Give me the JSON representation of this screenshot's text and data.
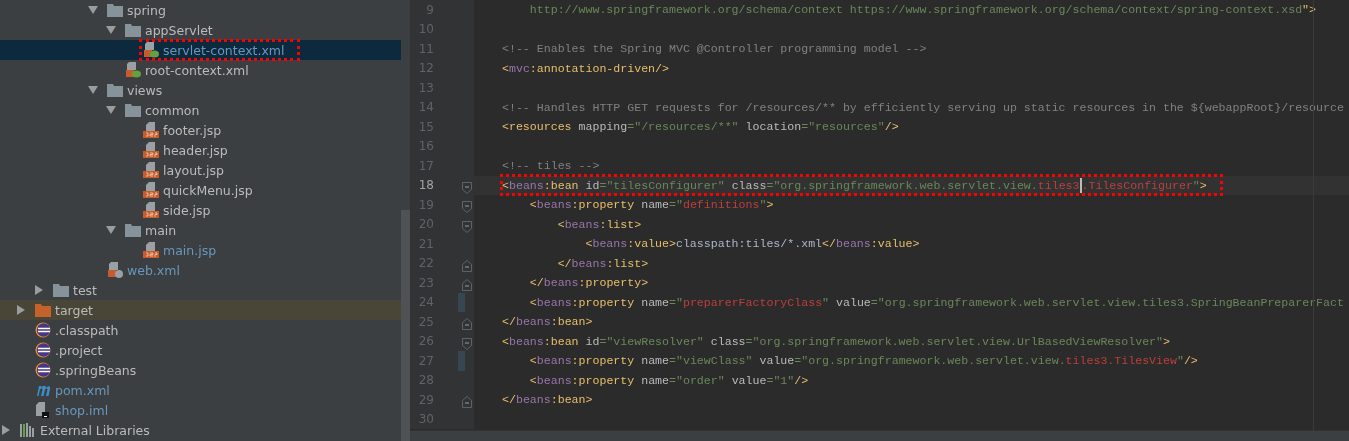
{
  "project_tree": {
    "items": [
      {
        "children": [
          {
            "children": [
              {
                "children": [
                  {
                    "children": [
                      {
                        "children": [
                          {
                            "label": "spring",
                            "kind": "folder",
                            "expanded": true,
                            "children": [
                              {
                                "label": "appServlet",
                                "kind": "folder",
                                "expanded": true,
                                "children": [
                                  {
                                    "label": "servlet-context.xml",
                                    "kind": "spring-xml",
                                    "modified": true,
                                    "selected": true,
                                    "marked": true
                                  }
                                ]
                              },
                              {
                                "label": "root-context.xml",
                                "kind": "spring-xml",
                                "modified": false,
                                "selected": false,
                                "marked": false
                              }
                            ]
                          },
                          {
                            "label": "views",
                            "kind": "folder",
                            "expanded": true,
                            "children": [
                              {
                                "label": "common",
                                "kind": "folder",
                                "expanded": true,
                                "children": [
                                  {
                                    "label": "footer.jsp",
                                    "kind": "jsp",
                                    "modified": false,
                                    "selected": false,
                                    "marked": false
                                  },
                                  {
                                    "label": "header.jsp",
                                    "kind": "jsp",
                                    "modified": false,
                                    "selected": false,
                                    "marked": false
                                  },
                                  {
                                    "label": "layout.jsp",
                                    "kind": "jsp",
                                    "modified": false,
                                    "selected": false,
                                    "marked": false
                                  },
                                  {
                                    "label": "quickMenu.jsp",
                                    "kind": "jsp",
                                    "modified": false,
                                    "selected": false,
                                    "marked": false
                                  },
                                  {
                                    "label": "side.jsp",
                                    "kind": "jsp",
                                    "modified": false,
                                    "selected": false,
                                    "marked": false
                                  }
                                ]
                              },
                              {
                                "label": "main",
                                "kind": "folder",
                                "expanded": true,
                                "children": [
                                  {
                                    "label": "main.jsp",
                                    "kind": "jsp",
                                    "modified": true,
                                    "selected": false,
                                    "marked": false
                                  }
                                ]
                              }
                            ]
                          },
                          {
                            "label": "web.xml",
                            "kind": "web-xml",
                            "modified": true,
                            "selected": false,
                            "marked": false
                          }
                        ]
                      }
                    ]
                  }
                ]
              },
              {
                "label": "test",
                "kind": "folder",
                "expanded": false
              }
            ]
          },
          {
            "label": "target",
            "kind": "excluded-folder",
            "expanded": false,
            "highlighted": true
          },
          {
            "label": ".classpath",
            "kind": "eclipse",
            "modified": false,
            "selected": false,
            "marked": false
          },
          {
            "label": ".project",
            "kind": "eclipse",
            "modified": false,
            "selected": false,
            "marked": false
          },
          {
            "label": ".springBeans",
            "kind": "eclipse",
            "modified": false,
            "selected": false,
            "marked": false
          },
          {
            "label": "pom.xml",
            "kind": "maven",
            "modified": true,
            "selected": false,
            "marked": false
          },
          {
            "label": "shop.iml",
            "kind": "module",
            "modified": true,
            "selected": false,
            "marked": false
          }
        ]
      },
      {
        "label": "External Libraries",
        "kind": "libraries",
        "expanded": false
      }
    ]
  },
  "editor": {
    "lines": [
      {
        "number": "9",
        "tokens": [
          {
            "kind": "value",
            "text": "    http://www.springframework.org/schema/context https://www.springframework.org/schema/context/spring-context.xsd"
          },
          {
            "kind": "tag",
            "text": "\">"
          }
        ]
      },
      {
        "number": "10"
      },
      {
        "number": "11",
        "tokens": [
          {
            "kind": "comment",
            "text": "<!-- Enables the Spring MVC @Controller programming model -->"
          }
        ]
      },
      {
        "number": "12",
        "tokens": [
          {
            "kind": "tag",
            "text": "<"
          },
          {
            "kind": "ns",
            "text": "mvc"
          },
          {
            "kind": "tag",
            "text": ":annotation-driven/>"
          }
        ]
      },
      {
        "number": "13"
      },
      {
        "number": "14",
        "tokens": [
          {
            "kind": "comment",
            "text": "<!-- Handles HTTP GET requests for /resources/** by efficiently serving up static resources in the ${webappRoot}/resource"
          }
        ]
      },
      {
        "number": "15",
        "tokens": [
          {
            "kind": "tag",
            "text": "<resources"
          },
          {
            "kind": "attr",
            "text": " mapping"
          },
          {
            "kind": "value",
            "text": "=\"/resources/**\""
          },
          {
            "kind": "attr",
            "text": " location"
          },
          {
            "kind": "value",
            "text": "=\"resources\""
          },
          {
            "kind": "tag",
            "text": "/>"
          }
        ]
      },
      {
        "number": "16"
      },
      {
        "number": "17",
        "tokens": [
          {
            "kind": "comment",
            "text": "<!-- tiles -->"
          }
        ]
      },
      {
        "number": "18",
        "current": true,
        "marked": true,
        "fold_start": true,
        "tokens": [
          {
            "kind": "tag",
            "text": "<"
          },
          {
            "kind": "ns",
            "text": "beans"
          },
          {
            "kind": "tag",
            "text": ":bean"
          },
          {
            "kind": "attr",
            "text": " id"
          },
          {
            "kind": "value",
            "text": "=\"tilesConfigurer\""
          },
          {
            "kind": "attr",
            "text": " class"
          },
          {
            "kind": "value",
            "text": "=\"org.springframework.web.servlet.view."
          },
          {
            "kind": "error",
            "text": "tiles3",
            "caret_after": true
          },
          {
            "kind": "error",
            "text": ".TilesConfigurer"
          },
          {
            "kind": "value",
            "text": "\""
          },
          {
            "kind": "tag",
            "text": ">"
          }
        ]
      },
      {
        "number": "19",
        "fold_start": true,
        "tokens": [
          {
            "kind": "tag",
            "text": "    <"
          },
          {
            "kind": "ns",
            "text": "beans"
          },
          {
            "kind": "tag",
            "text": ":property"
          },
          {
            "kind": "attr",
            "text": " name"
          },
          {
            "kind": "value",
            "text": "=\""
          },
          {
            "kind": "error",
            "text": "definitions"
          },
          {
            "kind": "value",
            "text": "\""
          },
          {
            "kind": "tag",
            "text": ">"
          }
        ]
      },
      {
        "number": "20",
        "fold_start": true,
        "tokens": [
          {
            "kind": "tag",
            "text": "        <"
          },
          {
            "kind": "ns",
            "text": "beans"
          },
          {
            "kind": "tag",
            "text": ":list>"
          }
        ]
      },
      {
        "number": "21",
        "tokens": [
          {
            "kind": "tag",
            "text": "            <"
          },
          {
            "kind": "ns",
            "text": "beans"
          },
          {
            "kind": "tag",
            "text": ":value>"
          },
          {
            "kind": "text",
            "text": "classpath:tiles/*.xml"
          },
          {
            "kind": "tag",
            "text": "</"
          },
          {
            "kind": "ns",
            "text": "beans"
          },
          {
            "kind": "tag",
            "text": ":value>"
          }
        ]
      },
      {
        "number": "22",
        "fold_end": true,
        "tokens": [
          {
            "kind": "tag",
            "text": "        </"
          },
          {
            "kind": "ns",
            "text": "beans"
          },
          {
            "kind": "tag",
            "text": ":list>"
          }
        ]
      },
      {
        "number": "23",
        "fold_end": true,
        "tokens": [
          {
            "kind": "tag",
            "text": "    </"
          },
          {
            "kind": "ns",
            "text": "beans"
          },
          {
            "kind": "tag",
            "text": ":property>"
          }
        ]
      },
      {
        "number": "24",
        "changed": true,
        "tokens": [
          {
            "kind": "tag",
            "text": "    <"
          },
          {
            "kind": "ns",
            "text": "beans"
          },
          {
            "kind": "tag",
            "text": ":property"
          },
          {
            "kind": "attr",
            "text": " name"
          },
          {
            "kind": "value",
            "text": "=\""
          },
          {
            "kind": "error",
            "text": "preparerFactoryClass"
          },
          {
            "kind": "value",
            "text": "\""
          },
          {
            "kind": "attr",
            "text": " value"
          },
          {
            "kind": "value",
            "text": "=\"org.springframework.web.servlet.view.tiles3.SpringBeanPreparerFact"
          }
        ]
      },
      {
        "number": "25",
        "fold_end": true,
        "tokens": [
          {
            "kind": "tag",
            "text": "</"
          },
          {
            "kind": "ns",
            "text": "beans"
          },
          {
            "kind": "tag",
            "text": ":bean>"
          }
        ]
      },
      {
        "number": "26",
        "fold_start": true,
        "tokens": [
          {
            "kind": "tag",
            "text": "<"
          },
          {
            "kind": "ns",
            "text": "beans"
          },
          {
            "kind": "tag",
            "text": ":bean"
          },
          {
            "kind": "attr",
            "text": " id"
          },
          {
            "kind": "value",
            "text": "=\"viewResolver\""
          },
          {
            "kind": "attr",
            "text": " class"
          },
          {
            "kind": "value",
            "text": "=\"org.springframework.web.servlet.view.UrlBasedViewResolver\""
          },
          {
            "kind": "tag",
            "text": ">"
          }
        ]
      },
      {
        "number": "27",
        "changed": true,
        "tokens": [
          {
            "kind": "tag",
            "text": "    <"
          },
          {
            "kind": "ns",
            "text": "beans"
          },
          {
            "kind": "tag",
            "text": ":property"
          },
          {
            "kind": "attr",
            "text": " name"
          },
          {
            "kind": "value",
            "text": "=\"viewClass\""
          },
          {
            "kind": "attr",
            "text": " value"
          },
          {
            "kind": "value",
            "text": "=\"org.springframework.web.servlet.view."
          },
          {
            "kind": "error",
            "text": "tiles3.TilesView"
          },
          {
            "kind": "value",
            "text": "\""
          },
          {
            "kind": "tag",
            "text": "/>"
          }
        ]
      },
      {
        "number": "28",
        "tokens": [
          {
            "kind": "tag",
            "text": "    <"
          },
          {
            "kind": "ns",
            "text": "beans"
          },
          {
            "kind": "tag",
            "text": ":property"
          },
          {
            "kind": "attr",
            "text": " name"
          },
          {
            "kind": "value",
            "text": "=\"order\""
          },
          {
            "kind": "attr",
            "text": " value"
          },
          {
            "kind": "value",
            "text": "=\"1\""
          },
          {
            "kind": "tag",
            "text": "/>"
          }
        ]
      },
      {
        "number": "29",
        "fold_end": true,
        "tokens": [
          {
            "kind": "tag",
            "text": "</"
          },
          {
            "kind": "ns",
            "text": "beans"
          },
          {
            "kind": "tag",
            "text": ":bean>"
          }
        ]
      },
      {
        "number": "30"
      }
    ]
  }
}
